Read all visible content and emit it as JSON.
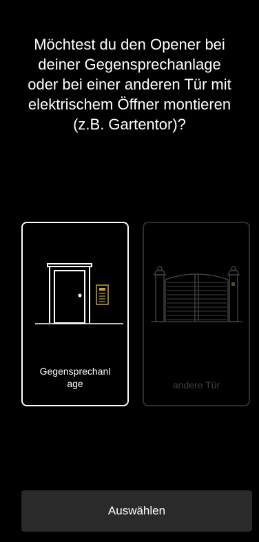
{
  "question": {
    "line1": "Möchtest du den Opener bei",
    "line2": "deiner Gegensprechanlage",
    "line3": "oder bei einer anderen Tür mit",
    "line4": "elektrischem Öffner montieren",
    "line5": "(z.B. Gartentor)?"
  },
  "options": [
    {
      "label_line1": "Gegensprechanl",
      "label_line2": "age",
      "selected": true,
      "icon": "door-intercom-icon"
    },
    {
      "label": "andere Tür",
      "selected": false,
      "icon": "garden-gate-icon"
    }
  ],
  "action_button": {
    "label": "Auswählen"
  },
  "colors": {
    "background": "#000000",
    "text": "#ffffff",
    "accent_gold": "#c9a227",
    "button_bg": "#2a2a2a",
    "disabled": "#3f3f3f"
  }
}
